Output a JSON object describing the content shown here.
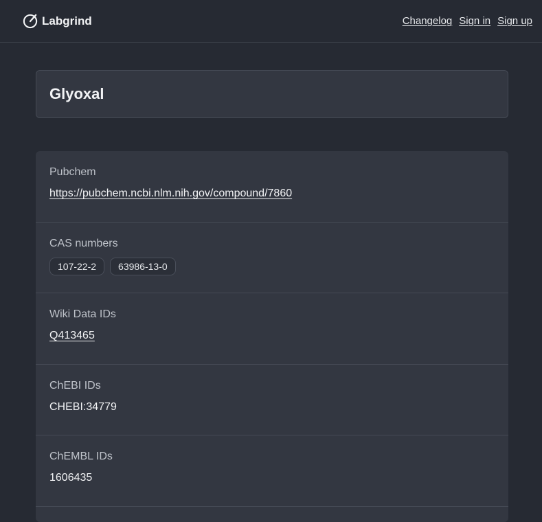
{
  "header": {
    "brand": "Labgrind",
    "brand_icon": "gauge-icon",
    "nav": {
      "changelog": "Changelog",
      "sign_in": "Sign in",
      "sign_up": "Sign up"
    }
  },
  "compound": {
    "title": "Glyoxal"
  },
  "details": {
    "pubchem": {
      "label": "Pubchem",
      "url": "https://pubchem.ncbi.nlm.nih.gov/compound/7860"
    },
    "cas": {
      "label": "CAS numbers",
      "values": [
        "107-22-2",
        "63986-13-0"
      ]
    },
    "wikidata": {
      "label": "Wiki Data IDs",
      "value": "Q413465"
    },
    "chebi": {
      "label": "ChEBI IDs",
      "value": "CHEBI:34779"
    },
    "chembl": {
      "label": "ChEMBL IDs",
      "value": "1606435"
    }
  },
  "colors": {
    "background": "#262a33",
    "card": "#333741",
    "border": "#454a55",
    "text": "#e6e8eb",
    "muted": "#bfc3ca"
  }
}
